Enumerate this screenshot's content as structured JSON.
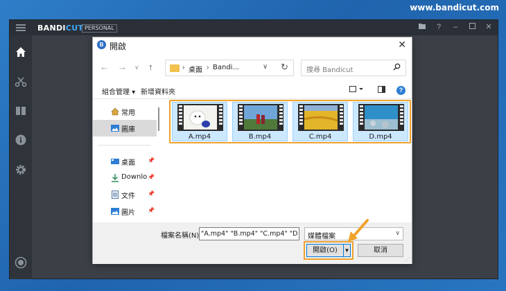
{
  "site": {
    "url": "www.bandicut.com"
  },
  "app": {
    "logo_main": "BANDI",
    "logo_accent": "CUT",
    "edition": "PERSONAL",
    "titlebar_icons": [
      "folder-icon",
      "help-icon",
      "minimize-icon",
      "maximize-icon",
      "close-icon"
    ],
    "sidebar_icons": [
      "home-icon",
      "cut-icon",
      "join-icon",
      "info-icon",
      "settings-icon",
      "record-icon"
    ]
  },
  "dialog": {
    "title_icon": "B",
    "title": "開啟",
    "address": {
      "segments": [
        "桌面",
        "Bandi..."
      ]
    },
    "search_placeholder": "搜尋 Bandicut",
    "commands": {
      "organize": "組合管理 ▾",
      "new_folder": "新增資料夾"
    },
    "help_glyph": "?",
    "nav_items": [
      {
        "label": "常用",
        "icon": "home-icon"
      },
      {
        "label": "圖庫",
        "icon": "gallery-icon"
      },
      {
        "label": "桌面",
        "icon": "desktop-icon"
      },
      {
        "label": "Downlo",
        "icon": "download-icon"
      },
      {
        "label": "文件",
        "icon": "document-icon"
      },
      {
        "label": "圖片",
        "icon": "picture-icon"
      }
    ],
    "files": [
      {
        "name": "A.mp4"
      },
      {
        "name": "B.mp4"
      },
      {
        "name": "C.mp4"
      },
      {
        "name": "D.mp4"
      }
    ],
    "filename_label": "檔案名稱(N):",
    "filename_value": "\"A.mp4\" \"B.mp4\" \"C.mp4\" \"D",
    "filetype_value": "媒體檔案",
    "open_label": "開啟(O)",
    "cancel_label": "取消",
    "colors": {
      "highlight": "#f0a22c",
      "selection": "#cce8ff",
      "accent": "#0078d7"
    }
  }
}
